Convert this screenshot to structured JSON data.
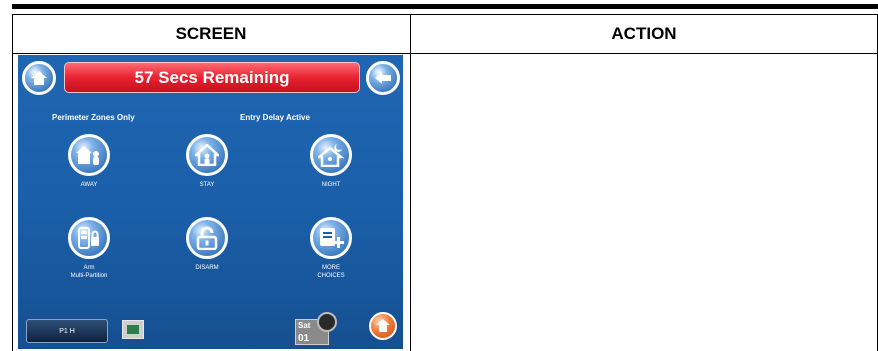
{
  "table": {
    "headers": [
      "SCREEN",
      "ACTION"
    ]
  },
  "keypad": {
    "banner": "57 Secs Remaining",
    "status_left": "Perimeter Zones Only",
    "status_right": "Entry Delay Active",
    "buttons": [
      {
        "label": "AWAY",
        "icon": "away-house-icon"
      },
      {
        "label": "STAY",
        "icon": "stay-house-icon"
      },
      {
        "label": "NIGHT",
        "icon": "night-house-icon"
      },
      {
        "label": "Arm\nMulti-Partition",
        "icon": "multi-partition-icon"
      },
      {
        "label": "DISARM",
        "icon": "unlock-icon"
      },
      {
        "label": "MORE\nCHOICES",
        "icon": "more-choices-icon"
      }
    ],
    "footer": {
      "partition": "P1 H",
      "day": "Sat",
      "date": "01"
    }
  },
  "colors": {
    "screen_blue": "#1a5ea8",
    "banner_red": "#e82231",
    "power_orange": "#f07b3a"
  }
}
